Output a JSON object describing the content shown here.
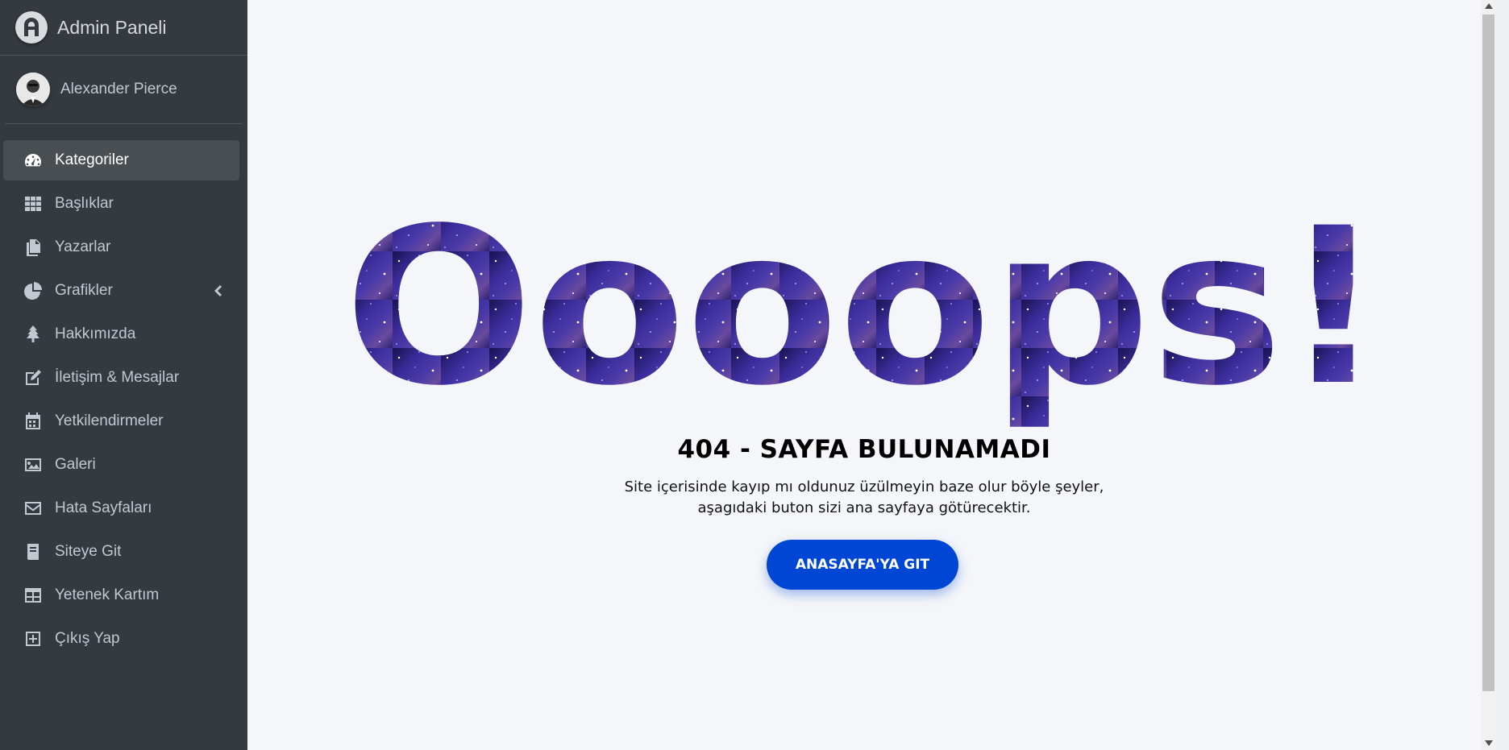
{
  "brand": {
    "title": "Admin Paneli"
  },
  "user": {
    "name": "Alexander Pierce"
  },
  "sidebar": {
    "items": [
      {
        "label": "Kategoriler",
        "icon": "dashboard-icon",
        "active": true
      },
      {
        "label": "Başlıklar",
        "icon": "grid-icon"
      },
      {
        "label": "Yazarlar",
        "icon": "copy-icon"
      },
      {
        "label": "Grafikler",
        "icon": "pie-chart-icon",
        "has_submenu": true
      },
      {
        "label": "Hakkımızda",
        "icon": "tree-icon"
      },
      {
        "label": "İletişim & Mesajlar",
        "icon": "edit-icon"
      },
      {
        "label": "Yetkilendirmeler",
        "icon": "calendar-icon"
      },
      {
        "label": "Galeri",
        "icon": "image-icon"
      },
      {
        "label": "Hata Sayfaları",
        "icon": "envelope-icon"
      },
      {
        "label": "Siteye Git",
        "icon": "book-icon"
      },
      {
        "label": "Yetenek Kartım",
        "icon": "table-icon"
      },
      {
        "label": "Çıkış Yap",
        "icon": "plus-square-icon"
      }
    ]
  },
  "error": {
    "headline": "Oooops!",
    "title": "404 - SAYFA BULUNAMADI",
    "description": "Site içerisinde kayıp mı oldunuz üzülmeyin baze olur böyle şeyler, aşagıdaki buton sizi ana sayfaya götürecektir.",
    "button_label": "ANASAYFA'YA GIT"
  },
  "colors": {
    "sidebar_bg": "#343a40",
    "content_bg": "#f4f6f9",
    "button_bg": "#0046d5",
    "headline_fill": "#2c1f7a"
  }
}
